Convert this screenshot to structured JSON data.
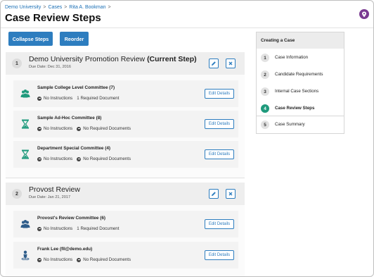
{
  "breadcrumb": {
    "items": [
      "Demo University",
      "Cases",
      "Rita A. Bookman"
    ],
    "separator": ">"
  },
  "page": {
    "title": "Case Review Steps"
  },
  "toolbar": {
    "collapse_label": "Collapse Steps",
    "reorder_label": "Reorder"
  },
  "steps": [
    {
      "number": "1",
      "title": "Demo University Promotion Review",
      "current_tag": "(Current Step)",
      "due": "Due Date: Dec 31, 2016",
      "committees": [
        {
          "name": "Sample College Level Committee (7)",
          "icon": "people-icon",
          "instructions": "No Instructions",
          "documents": "1 Required Document",
          "documents_has_dot": false,
          "edit_label": "Edit Details"
        },
        {
          "name": "Sample Ad-Hoc Committee (8)",
          "icon": "hourglass-icon",
          "instructions": "No Instructions",
          "documents": "No Required Documents",
          "documents_has_dot": true,
          "edit_label": "Edit Details"
        },
        {
          "name": "Department Special Committee (4)",
          "icon": "hourglass-icon",
          "instructions": "No Instructions",
          "documents": "No Required Documents",
          "documents_has_dot": true,
          "edit_label": "Edit Details"
        }
      ]
    },
    {
      "number": "2",
      "title": "Provost Review",
      "current_tag": "",
      "due": "Due Date: Jan 21, 2017",
      "committees": [
        {
          "name": "Provost's Review Committee (6)",
          "icon": "people-icon",
          "instructions": "No Instructions",
          "documents": "1 Required Document",
          "documents_has_dot": false,
          "edit_label": "Edit Details"
        },
        {
          "name": "Frank Lee (fll@demo.edu)",
          "icon": "person-icon",
          "instructions": "No Instructions",
          "documents": "No Required Documents",
          "documents_has_dot": true,
          "edit_label": "Edit Details"
        }
      ]
    }
  ],
  "sidebar": {
    "title": "Creating a Case",
    "items": [
      {
        "number": "1",
        "label": "Case Information",
        "active": false
      },
      {
        "number": "2",
        "label": "Candidate Requirements",
        "active": false
      },
      {
        "number": "3",
        "label": "Internal Case Sections",
        "active": false
      },
      {
        "number": "4",
        "label": "Case Review Steps",
        "active": true
      },
      {
        "number": "5",
        "label": "Case Summary",
        "active": false
      }
    ]
  },
  "colors": {
    "primary": "#2d7dbf",
    "teal": "#1f9a7c",
    "people_icon": "#2f5d8a",
    "pin": "#7a3a91"
  },
  "icons": {
    "pin": "map-pin-icon",
    "edit": "pencil-icon",
    "close": "close-icon"
  }
}
